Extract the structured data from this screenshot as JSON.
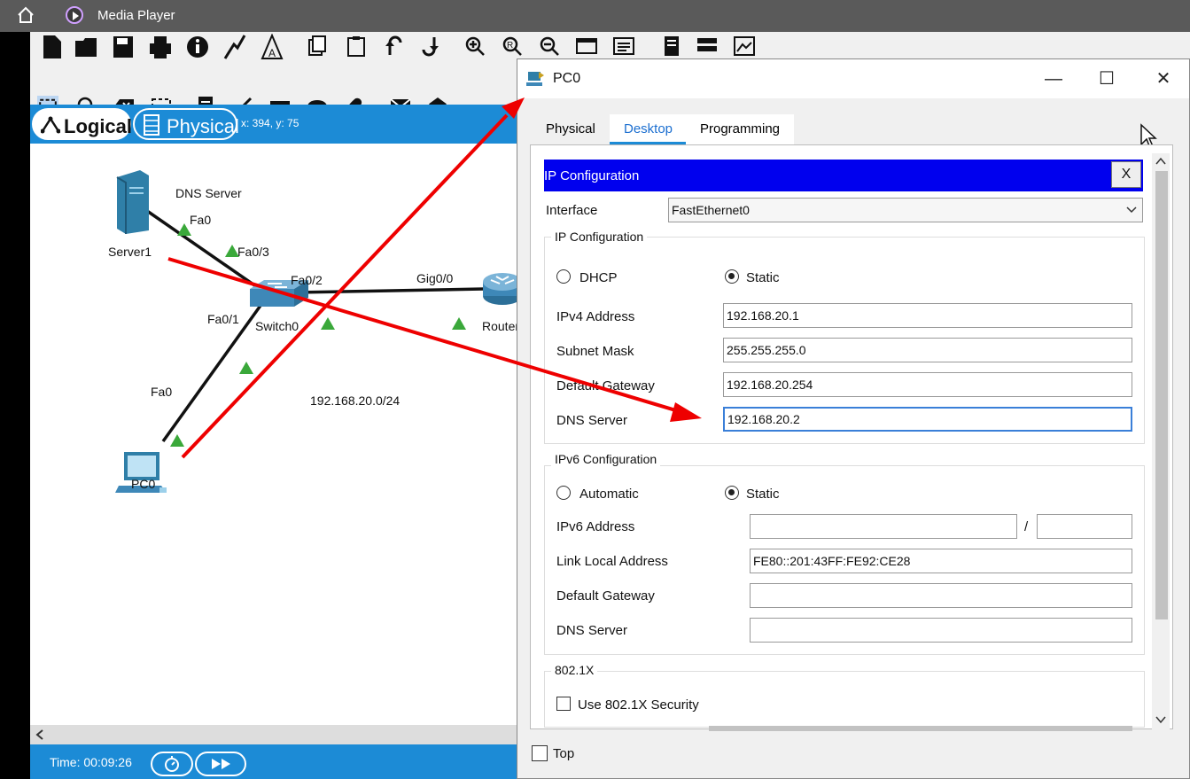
{
  "media_player": {
    "title": "Media Player"
  },
  "workspace": {
    "tab_logical": "Logical",
    "tab_physical": "Physical",
    "coords": "x: 394, y: 75",
    "time": "Time: 00:09:26"
  },
  "topology": {
    "dns_server_label": "DNS Server",
    "server_name": "Server1",
    "server_port": "Fa0",
    "switch_port_fa03": "Fa0/3",
    "switch_port_fa02": "Fa0/2",
    "switch_port_fa01": "Fa0/1",
    "switch_name": "Switch0",
    "router_port": "Gig0/0",
    "router_name": "Router",
    "pc_port": "Fa0",
    "pc_name": "PC0",
    "network": "192.168.20.0/24"
  },
  "dialog": {
    "title": "PC0",
    "minimize": "—",
    "maximize": "☐",
    "close": "✕",
    "tabs": [
      "Physical",
      "Desktop",
      "Programming"
    ],
    "ip_config_header": "IP Configuration",
    "header_close": "X",
    "interface_label": "Interface",
    "interface_value": "FastEthernet0",
    "ipv4_group": "IP Configuration",
    "dhcp_label": "DHCP",
    "static_label": "Static",
    "ipv4_address_label": "IPv4 Address",
    "ipv4_address": "192.168.20.1",
    "subnet_label": "Subnet Mask",
    "subnet": "255.255.255.0",
    "gateway_label": "Default Gateway",
    "gateway": "192.168.20.254",
    "dns_label": "DNS Server",
    "dns": "192.168.20.2",
    "ipv6_group": "IPv6 Configuration",
    "automatic_label": "Automatic",
    "static6_label": "Static",
    "ipv6_address_label": "IPv6 Address",
    "ipv6_address": "",
    "ipv6_prefix": "",
    "slash": "/",
    "link_local_label": "Link Local Address",
    "link_local": "FE80::201:43FF:FE92:CE28",
    "gateway6_label": "Default Gateway",
    "gateway6": "",
    "dns6_label": "DNS Server",
    "dns6": "",
    "dot1x_group": "802.1X",
    "dot1x_label": "Use 802.1X Security",
    "top_label": "Top"
  },
  "colors": {
    "accent_blue": "#1c8bd6",
    "ip_header_blue": "#0000ee",
    "arrow_red": "#ee0000",
    "link_green": "#3aa83a"
  }
}
